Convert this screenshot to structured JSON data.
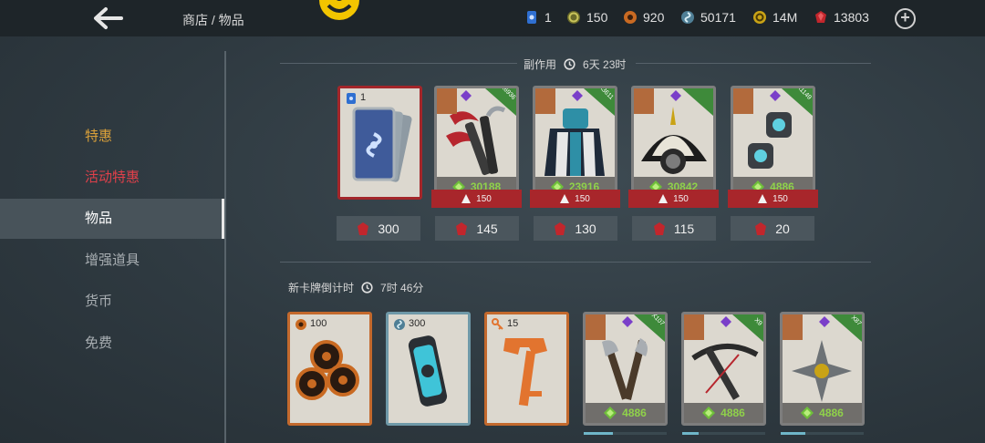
{
  "header": {
    "breadcrumb": "商店 / 物品",
    "currencies": [
      {
        "icon": "blue-card-icon",
        "value": "1"
      },
      {
        "icon": "gear-coin-icon",
        "value": "150"
      },
      {
        "icon": "orange-token-icon",
        "value": "920"
      },
      {
        "icon": "spiral-orb-icon",
        "value": "50171"
      },
      {
        "icon": "gold-coin-icon",
        "value": "14M"
      },
      {
        "icon": "ruby-gem-icon",
        "value": "13803"
      }
    ]
  },
  "sidebar": {
    "items": [
      {
        "label": "特惠",
        "color": "#d9a03a"
      },
      {
        "label": "活动特惠",
        "color": "#e0404a"
      },
      {
        "label": "物品",
        "color": "#ffffff"
      },
      {
        "label": "增强道具",
        "color": "#a8aeb2"
      },
      {
        "label": "货币",
        "color": "#a8aeb2"
      },
      {
        "label": "免费",
        "color": "#a8aeb2"
      }
    ]
  },
  "section1": {
    "title": "副作用",
    "timer": "6天 23时",
    "cards": [
      {
        "type": "card-pack",
        "quantity": "1",
        "price": "300"
      },
      {
        "type": "blade-weapon",
        "count": "X6936",
        "power": "30188",
        "requirement": "150",
        "price": "145"
      },
      {
        "type": "armor",
        "count": "X3611",
        "power": "23916",
        "requirement": "150",
        "price": "130"
      },
      {
        "type": "helmet",
        "count": "",
        "power": "30842",
        "requirement": "150",
        "price": "115"
      },
      {
        "type": "gadget",
        "count": "X1149",
        "power": "4886",
        "requirement": "150",
        "price": "20"
      }
    ]
  },
  "section2": {
    "title": "新卡牌倒计时",
    "timer": "7时 46分",
    "cards": [
      {
        "type": "tokens",
        "quantity": "100"
      },
      {
        "type": "capsule",
        "quantity": "300"
      },
      {
        "type": "key",
        "quantity": "15"
      },
      {
        "type": "axes",
        "count": "X107",
        "power": "4886",
        "progress": 0.35
      },
      {
        "type": "crossbow",
        "count": "X9",
        "power": "4886",
        "progress": 0.2
      },
      {
        "type": "shuriken",
        "count": "X87",
        "power": "4886",
        "progress": 0.3
      }
    ]
  },
  "colors": {
    "accent_red": "#a8262b",
    "power_green": "#8fd14a",
    "gem_purple": "#7a3fc9",
    "count_green": "#3e8a3a"
  }
}
